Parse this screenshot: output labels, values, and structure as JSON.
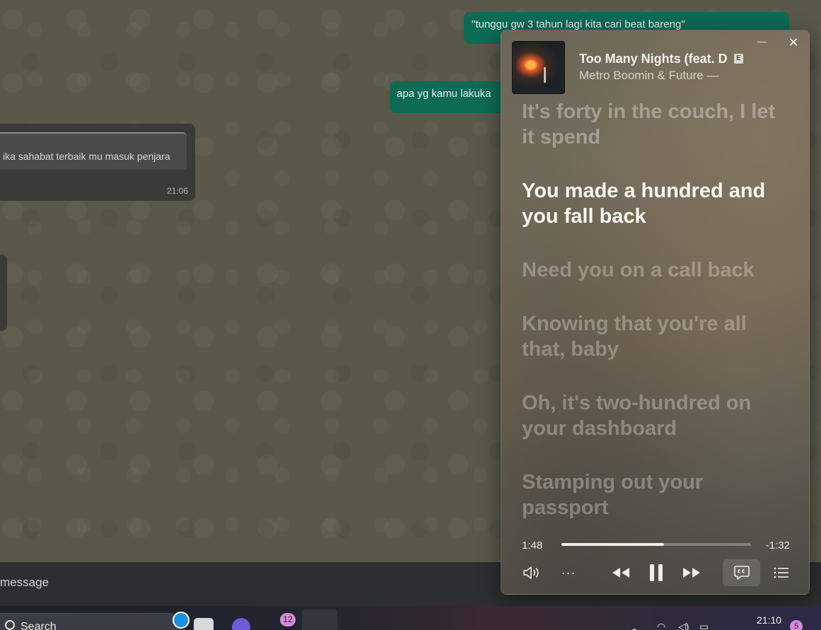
{
  "chat": {
    "messages": [
      {
        "direction": "out",
        "text": "\"tunggu gw 3 tahun lagi kita cari beat bareng\""
      },
      {
        "direction": "out",
        "text": "apa yg kamu lakuka"
      },
      {
        "direction": "in",
        "quote": "ika sahabat terbaik mu masuk penjara",
        "time": "21:06"
      }
    ],
    "composer_placeholder": "message"
  },
  "player": {
    "title": "Too Many Nights (feat. D",
    "explicit_badge": "E",
    "artist": "Metro Boomin & Future —",
    "lyrics": [
      {
        "text": "It's forty in the couch, I let it spend",
        "current": false
      },
      {
        "text": "You made a hundred and you fall back",
        "current": true
      },
      {
        "text": "Need you on a call back",
        "current": false
      },
      {
        "text": "Knowing that you're all that, baby",
        "current": false
      },
      {
        "text": "Oh, it's two-hundred on your dashboard",
        "current": false
      },
      {
        "text": "Stamping out your passport",
        "current": false
      }
    ],
    "elapsed": "1:48",
    "remaining": "-1:32",
    "progress": 0.54,
    "more_label": "···",
    "close_label": "✕"
  },
  "taskbar": {
    "search_label": "Search",
    "badge_count": "12",
    "clock": "21:10",
    "notification_count": "5"
  },
  "colors": {
    "outgoing_bubble": "#0d6b55",
    "incoming_bubble": "#3a3a39",
    "badge": "#d48bdc"
  }
}
